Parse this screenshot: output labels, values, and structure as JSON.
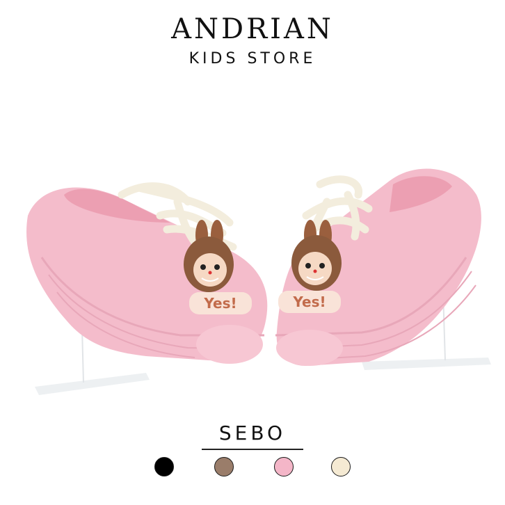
{
  "brand": {
    "name": "ANDRIAN",
    "subtitle": "KIDS STORE"
  },
  "product": {
    "name": "SEBO",
    "charm_text": "Yes!"
  },
  "colors": {
    "swatches": [
      "#000000",
      "#9a7d6a",
      "#f4b6c8",
      "#f5ead3"
    ],
    "shoe": "#f6bfcd",
    "laces": "#f7f2e6",
    "charm": "#8b5a3c"
  }
}
